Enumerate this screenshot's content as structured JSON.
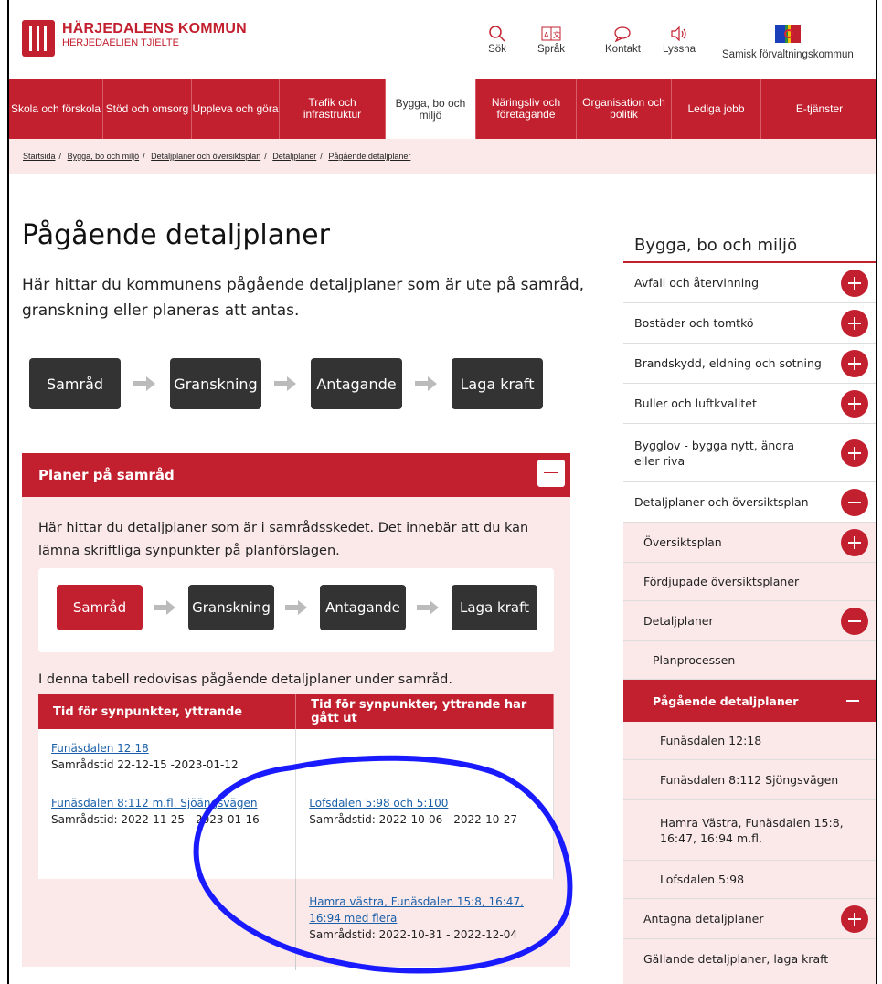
{
  "header": {
    "logo_title": "HÄRJEDALENS KOMMUN",
    "logo_subtitle": "HERJEDAELIEN TJÏELTE",
    "tools": [
      {
        "label": "Sök",
        "icon": "search-icon"
      },
      {
        "label": "Språk",
        "icon": "language-icon"
      },
      {
        "label": "Kontakt",
        "icon": "chat-icon"
      },
      {
        "label": "Lyssna",
        "icon": "speaker-icon"
      },
      {
        "label": "Samisk förvaltningskommun",
        "icon": "sami-flag-icon"
      }
    ]
  },
  "nav": [
    {
      "label": "Skola och förskola"
    },
    {
      "label": "Stöd och omsorg"
    },
    {
      "label": "Uppleva och göra"
    },
    {
      "label": "Trafik och infrastruktur"
    },
    {
      "label": "Bygga, bo och miljö"
    },
    {
      "label": "Näringsliv och företagande"
    },
    {
      "label": "Organisation och politik"
    },
    {
      "label": "Lediga jobb"
    },
    {
      "label": "E-tjänster"
    }
  ],
  "breadcrumbs": [
    "Startsida",
    "Bygga, bo och miljö",
    "Detaljplaner och översiktsplan",
    "Detaljplaner",
    "Pågående detaljplaner"
  ],
  "page": {
    "title": "Pågående detaljplaner",
    "lead": "Här hittar du kommunens pågående detaljplaner som är ute på samråd, granskning eller planeras att antas."
  },
  "process_steps": [
    "Samråd",
    "Granskning",
    "Antagande",
    "Laga kraft"
  ],
  "accordion": {
    "title": "Planer på samråd",
    "text": "Här hittar du detaljplaner som är i samrådsskedet. Det innebär att du kan lämna skriftliga synpunkter på planförslagen.",
    "table_caption": "I denna tabell redovisas pågående detaljplaner under samråd.",
    "columns": [
      "Tid för synpunkter, yttrande",
      "Tid för synpunkter, yttrande har gått ut"
    ],
    "rows": [
      {
        "left_link": "Funäsdalen 12:18",
        "left_text": "Samrådstid 22-12-15 -2023-01-12",
        "right_link": "",
        "right_text": ""
      },
      {
        "left_link": "Funäsdalen 8:112 m.fl. Sjöängsvägen",
        "left_text": "Samrådstid: 2022-11-25 - 2023-01-16",
        "right_link": "Lofsdalen 5:98 och 5:100",
        "right_text": "Samrådstid: 2022-10-06 - 2022-10-27"
      },
      {
        "left_link": "",
        "left_text": "",
        "right_link": "Hamra västra, Funäsdalen 15:8, 16:47, 16:94 med flera",
        "right_text": "Samrådstid: 2022-10-31 - 2022-12-04"
      }
    ]
  },
  "sidebar": {
    "title": "Bygga, bo och miljö",
    "items": [
      {
        "label": "Avfall och återvinning"
      },
      {
        "label": "Bostäder och tomtkö"
      },
      {
        "label": "Brandskydd, eldning och sotning"
      },
      {
        "label": "Buller och luftkvalitet"
      },
      {
        "label": "Bygglov - bygga nytt, ändra eller riva"
      },
      {
        "label": "Detaljplaner och översiktsplan"
      },
      {
        "label": "Översiktsplan"
      },
      {
        "label": "Fördjupade översiktsplaner"
      },
      {
        "label": "Detaljplaner"
      },
      {
        "label": "Planprocessen"
      },
      {
        "label": "Pågående detaljplaner"
      },
      {
        "label": "Funäsdalen 12:18"
      },
      {
        "label": "Funäsdalen 8:112 Sjöngsvägen"
      },
      {
        "label": "Hamra Västra, Funäsdalen 15:8, 16:47, 16:94 m.fl."
      },
      {
        "label": "Lofsdalen 5:98"
      },
      {
        "label": "Antagna detaljplaner"
      },
      {
        "label": "Gällande detaljplaner, laga kraft"
      }
    ]
  },
  "colors": {
    "brand": "#c3202f",
    "tint": "#fbe9ea",
    "dark_step": "#333333",
    "link": "#1a5fa8",
    "annotation": "#1a1aff"
  }
}
